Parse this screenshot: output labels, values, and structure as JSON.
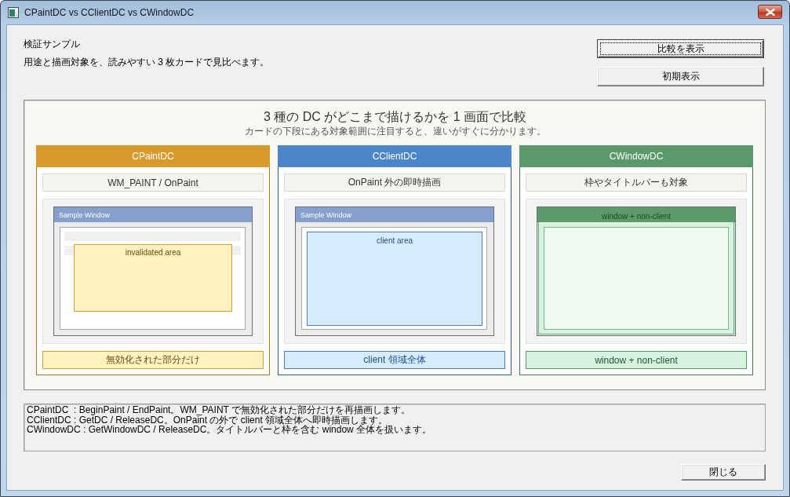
{
  "window": {
    "title": "CPaintDC vs CClientDC vs CWindowDC"
  },
  "header": {
    "title": "検証サンプル",
    "description": "用途と描画対象を、読みやすい 3 枚カードで見比べます。"
  },
  "buttons": [
    {
      "label": "比較を表示",
      "default": true
    },
    {
      "label": "初期表示",
      "default": false
    }
  ],
  "comparison": {
    "title": "3 種の DC がどこまで描けるかを 1 画面で比較",
    "subtitle": "カードの下段にある対象範囲に注目すると、違いがすぐに分かります。",
    "cards": [
      {
        "name": "CPaintDC",
        "kind": "invalidated",
        "color": "#d99a2b",
        "purpose": "WM_PAINT / OnPaint",
        "window_title": "Sample Window",
        "area_label": "invalidated area",
        "scope": "無効化された部分だけ"
      },
      {
        "name": "CClientDC",
        "kind": "client",
        "color": "#4a86c8",
        "purpose": "OnPaint 外の即時描画",
        "window_title": "Sample Window",
        "area_label": "client area",
        "scope": "client 領域全体"
      },
      {
        "name": "CWindowDC",
        "kind": "window",
        "color": "#5a9a6a",
        "purpose": "枠やタイトルバーも対象",
        "window_title": "window + non-client",
        "scope": "window + non-client"
      }
    ]
  },
  "log": {
    "lines": [
      "CPaintDC  : BeginPaint / EndPaint。WM_PAINT で無効化された部分だけを再描画します。",
      "CClientDC : GetDC / ReleaseDC。OnPaint の外で client 領域全体へ即時描画します。",
      "CWindowDC : GetWindowDC / ReleaseDC。タイトルバーと枠を含む window 全体を扱います。"
    ]
  },
  "close_button": {
    "label": "閉じる"
  }
}
